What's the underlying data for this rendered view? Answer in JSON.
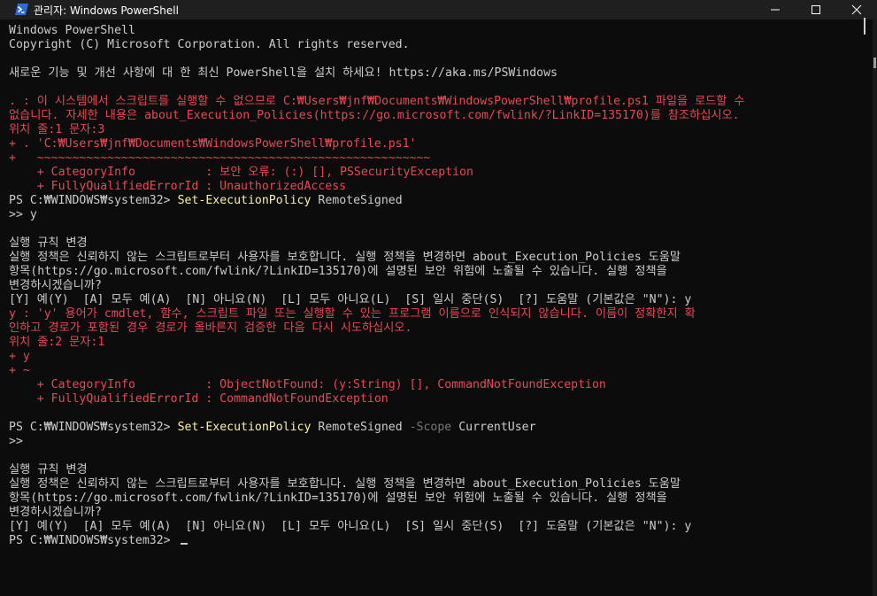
{
  "window": {
    "title": "관리자: Windows PowerShell",
    "app_icon": "powershell-icon",
    "controls": [
      "minimize-icon",
      "maximize-icon",
      "close-icon"
    ]
  },
  "colors": {
    "background": "#0c0c0c",
    "text": "#cccccc",
    "error": "#e74856",
    "command": "#f9f1a5",
    "parameter": "#767676",
    "titlebar": "#1f1f1f"
  },
  "console": {
    "lines": [
      "Windows PowerShell",
      "Copyright (C) Microsoft Corporation. All rights reserved.",
      "",
      "새로운 기능 및 개선 사항에 대 한 최신 PowerShell을 설치 하세요! https://aka.ms/PSWindows",
      "",
      ". : 이 시스템에서 스크립트를 실행할 수 없으므로 C:₩Users₩jnf₩Documents₩WindowsPowerShell₩profile.ps1 파일을 로드할 수",
      "없습니다. 자세한 내용은 about_Execution_Policies(https://go.microsoft.com/fwlink/?LinkID=135170)를 참조하십시오.",
      "위치 줄:1 문자:3",
      "+ . 'C:₩Users₩jnf₩Documents₩WindowsPowerShell₩profile.ps1'",
      "+   ~~~~~~~~~~~~~~~~~~~~~~~~~~~~~~~~~~~~~~~~~~~~~~~~~~~~~~~~",
      "    + CategoryInfo          : 보안 오류: (:) [], PSSecurityException",
      "    + FullyQualifiedErrorId : UnauthorizedAccess",
      "PS C:₩WINDOWS₩system32> ",
      ">> y",
      "",
      "실행 규칙 변경",
      "실행 정책은 신뢰하지 않는 스크립트로부터 사용자를 보호합니다. 실행 정책을 변경하면 about_Execution_Policies 도움말",
      "항목(https://go.microsoft.com/fwlink/?LinkID=135170)에 설명된 보안 위험에 노출될 수 있습니다. 실행 정책을",
      "변경하시겠습니까?",
      "[Y] 예(Y)  [A] 모두 예(A)  [N] 아니요(N)  [L] 모두 아니요(L)  [S] 일시 중단(S)  [?] 도움말 (기본값은 \"N\"): y",
      "y : 'y' 용어가 cmdlet, 함수, 스크립트 파일 또는 실행할 수 있는 프로그램 이름으로 인식되지 않습니다. 이름이 정확한지 확",
      "인하고 경로가 포함된 경우 경로가 올바른지 검증한 다음 다시 시도하십시오.",
      "위치 줄:2 문자:1",
      "+ y",
      "+ ~",
      "    + CategoryInfo          : ObjectNotFound: (y:String) [], CommandNotFoundException",
      "    + FullyQualifiedErrorId : CommandNotFoundException",
      "",
      "PS C:₩WINDOWS₩system32> ",
      ">>",
      "",
      "실행 규칙 변경",
      "실행 정책은 신뢰하지 않는 스크립트로부터 사용자를 보호합니다. 실행 정책을 변경하면 about_Execution_Policies 도움말",
      "항목(https://go.microsoft.com/fwlink/?LinkID=135170)에 설명된 보안 위험에 노출될 수 있습니다. 실행 정책을",
      "변경하시겠습니까?",
      "[Y] 예(Y)  [A] 모두 예(A)  [N] 아니요(N)  [L] 모두 아니요(L)  [S] 일시 중단(S)  [?] 도움말 (기본값은 \"N\"): y",
      "PS C:₩WINDOWS₩system32> "
    ],
    "commands": {
      "cmd1_name": "Set-ExecutionPolicy",
      "cmd1_arg": "RemoteSigned",
      "cmd2_name": "Set-ExecutionPolicy",
      "cmd2_arg": "RemoteSigned",
      "cmd2_param": "-Scope",
      "cmd2_value": "CurrentUser"
    }
  }
}
